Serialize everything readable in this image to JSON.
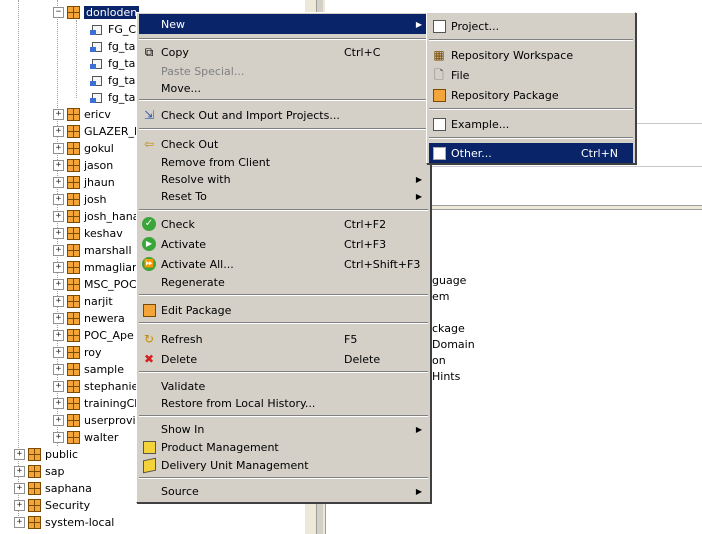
{
  "tree": {
    "selected_label": "donloden",
    "children": [
      "FG_CU",
      "fg_tas",
      "fg_tas",
      "fg_tas",
      "fg_tas"
    ],
    "packages": [
      "ericv",
      "GLAZER_F",
      "gokul",
      "jason",
      "jhaun",
      "josh",
      "josh_hana",
      "keshav",
      "marshall",
      "mmagliard",
      "MSC_POC",
      "narjit",
      "newera",
      "POC_Ape",
      "roy",
      "sample",
      "stephanie",
      "trainingCh",
      "userprovis",
      "walter"
    ],
    "root_packages": [
      "public",
      "sap",
      "saphana",
      "Security",
      "system-local"
    ],
    "expander_collapsed": "+",
    "expander_expanded": "−"
  },
  "context_menu": {
    "new": "New",
    "copy": "Copy",
    "copy_shortcut": "Ctrl+C",
    "paste_special": "Paste Special...",
    "move": "Move...",
    "check_out_import": "Check Out and Import Projects...",
    "check_out": "Check Out",
    "remove_from_client": "Remove from Client",
    "resolve_with": "Resolve with",
    "reset_to": "Reset To",
    "check": "Check",
    "check_shortcut": "Ctrl+F2",
    "activate": "Activate",
    "activate_shortcut": "Ctrl+F3",
    "activate_all": "Activate All...",
    "activate_all_shortcut": "Ctrl+Shift+F3",
    "regenerate": "Regenerate",
    "edit_package": "Edit Package",
    "refresh": "Refresh",
    "refresh_shortcut": "F5",
    "delete": "Delete",
    "delete_shortcut": "Delete",
    "validate": "Validate",
    "restore_history": "Restore from Local History...",
    "show_in": "Show In",
    "product_management": "Product Management",
    "delivery_unit_management": "Delivery Unit Management",
    "source": "Source"
  },
  "submenu": {
    "project": "Project...",
    "repository_workspace": "Repository Workspace",
    "file": "File",
    "repository_package": "Repository Package",
    "example": "Example...",
    "other": "Other...",
    "other_shortcut": "Ctrl+N"
  },
  "background_pane": {
    "fragments": [
      "guage",
      "em",
      "ckage",
      "Domain",
      "on",
      "Hints"
    ]
  },
  "colors": {
    "menu_bg": "#d4d0c8",
    "highlight": "#0a246a",
    "package_icon": "#f3a53a"
  }
}
